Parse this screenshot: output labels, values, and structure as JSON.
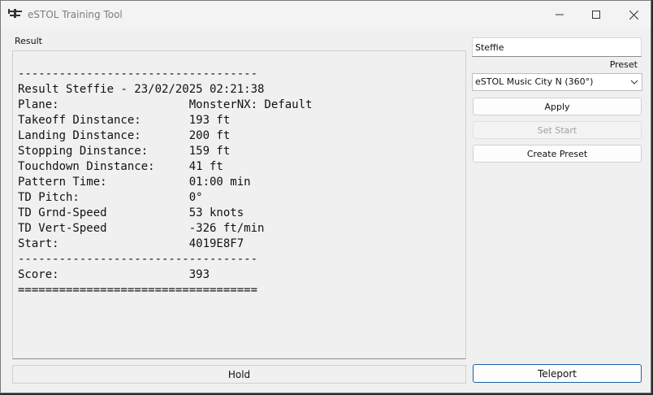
{
  "window": {
    "title": "eSTOL Training Tool",
    "controls": [
      "minimize-icon",
      "maximize-icon",
      "close-icon"
    ]
  },
  "result": {
    "label": "Result",
    "text": "-----------------------------------\nResult Steffie - 23/02/2025 02:21:38\nPlane:                   MonsterNX: Default\nTakeoff Dinstance:       193 ft\nLanding Dinstance:       200 ft\nStopping Dinstance:      159 ft\nTouchdown Dinstance:     41 ft\nPattern Time:            01:00 min\nTD Pitch:                0°\nTD Grnd-Speed            53 knots\nTD Vert-Speed            -326 ft/min\nStart:                   4019E8F7\n-----------------------------------\nScore:                   393\n==================================="
  },
  "hold_button": "Hold",
  "sidebar": {
    "name_value": "Steffie",
    "preset_label": "Preset",
    "preset_selected": "eSTOL Music City N (360°)",
    "apply_button": "Apply",
    "set_start_button": "Set Start",
    "create_preset_button": "Create Preset",
    "teleport_button": "Teleport"
  },
  "colors": {
    "background": "#f0f0f0",
    "accent_border": "#1e5fa8"
  }
}
